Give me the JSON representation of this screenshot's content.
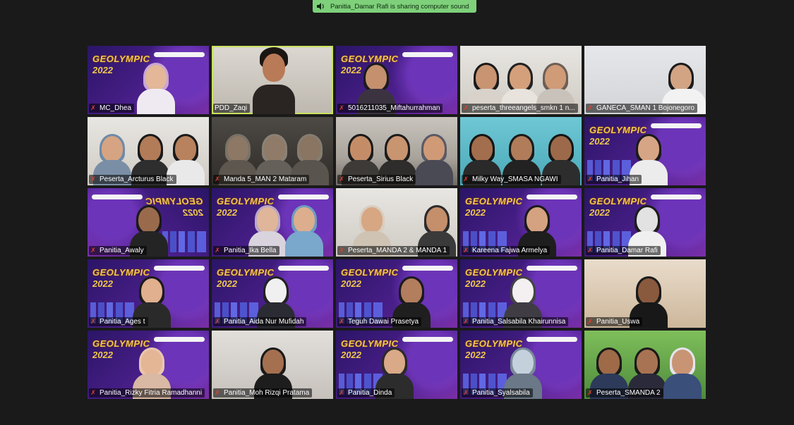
{
  "banner": {
    "icon": "speaker-icon",
    "text": "Panitia_Damar Rafi is sharing computer sound"
  },
  "branding": {
    "title": "GEOLYMPIC",
    "year": "2022"
  },
  "participants": [
    "MC_Dhea",
    "PDD_Zaqi",
    "5016211035_Miftahurrahman",
    "peserta_threeangels_smkn 1 n...",
    "GANECA_SMAN 1 Bojonegoro",
    "Peserta_Arcturus Black",
    "Manda 5_MAN 2 Mataram",
    "Peserta_Sirius Black",
    "Milky Way_SMASA NGAWI",
    "Panitia_Jihan",
    "Panitia_Awaly",
    "Panitia_Ika Bella",
    "Peserta_MANDA 2 & MANDA 1",
    "Kareena Fajwa Armelya",
    "Panitia_Damar Rafi",
    "Panitia_Ages t",
    "Panitia_Aida Nur Mufidah",
    "Teguh Dawai Prasetya",
    "Panitia_Salsabila Khairunnisa",
    "Panitia_Uswa",
    "Panitia_Rizky Fitria Ramadhanni",
    "Panitia_Moh Rizqi Pratama",
    "Panitia_Dinda",
    "Panitia_Syalsabila",
    "Peserta_SMANDA 2"
  ],
  "active_speaker": "PDD_Zaqi",
  "mic_icon": "muted-mic-icon"
}
